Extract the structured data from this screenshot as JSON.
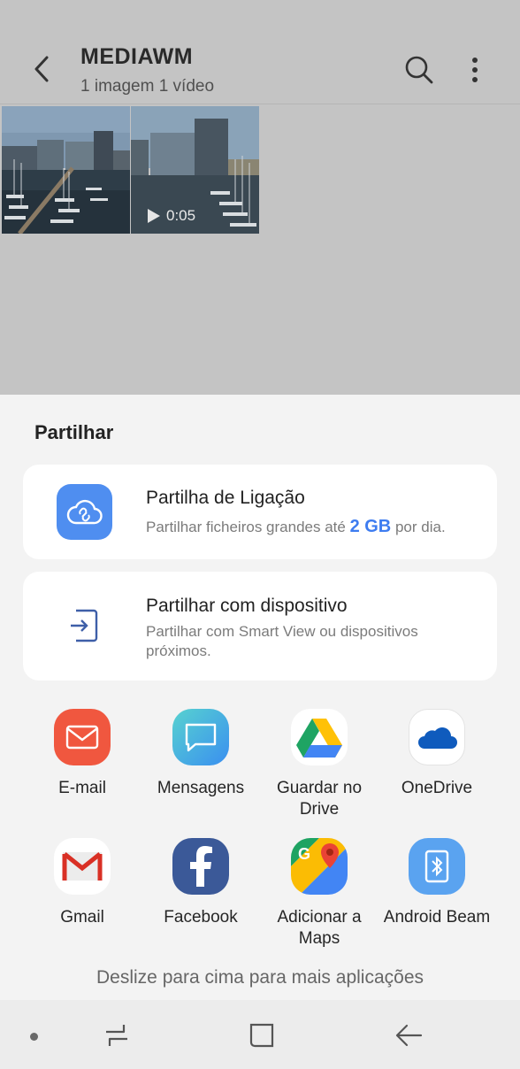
{
  "appbar": {
    "title": "MEDIAWM",
    "subtitle": "1 imagem  1 vídeo",
    "back_icon": "back-arrow-icon",
    "search_icon": "search-icon",
    "more_icon": "more-vert-icon"
  },
  "gallery": {
    "items": [
      {
        "type": "image"
      },
      {
        "type": "video",
        "duration": "0:05"
      }
    ]
  },
  "share": {
    "title": "Partilhar",
    "link_share": {
      "title": "Partilha de Ligação",
      "desc_before": "Partilhar ficheiros grandes até ",
      "desc_highlight": "2 GB",
      "desc_after": " por dia."
    },
    "device_share": {
      "title": "Partilhar com dispositivo",
      "desc": "Partilhar com Smart View ou dispositivos próximos."
    },
    "apps": [
      {
        "label": "E-mail",
        "icon": "email-icon",
        "color": "#f0573f"
      },
      {
        "label": "Mensagens",
        "icon": "messages-icon",
        "color": "#3db8e6"
      },
      {
        "label": "Guardar no Drive",
        "icon": "google-drive-icon",
        "color": "#ffffff"
      },
      {
        "label": "OneDrive",
        "icon": "onedrive-icon",
        "color": "#ffffff"
      },
      {
        "label": "Gmail",
        "icon": "gmail-icon",
        "color": "#ffffff"
      },
      {
        "label": "Facebook",
        "icon": "facebook-icon",
        "color": "#3b5998"
      },
      {
        "label": "Adicionar a Maps",
        "icon": "google-maps-icon",
        "color": "#ffffff"
      },
      {
        "label": "Android Beam",
        "icon": "android-beam-icon",
        "color": "#5aa3f0"
      }
    ],
    "hint": "Deslize para cima para mais aplicações"
  },
  "navbar": {
    "dot_icon": "nav-dot-icon",
    "recents_icon": "recents-icon",
    "home_icon": "home-icon",
    "back_icon": "nav-back-icon"
  },
  "colors": {
    "accent": "#3d7cf0",
    "sheet_bg": "#f3f3f3",
    "dim_bg": "#c4c4c4"
  }
}
